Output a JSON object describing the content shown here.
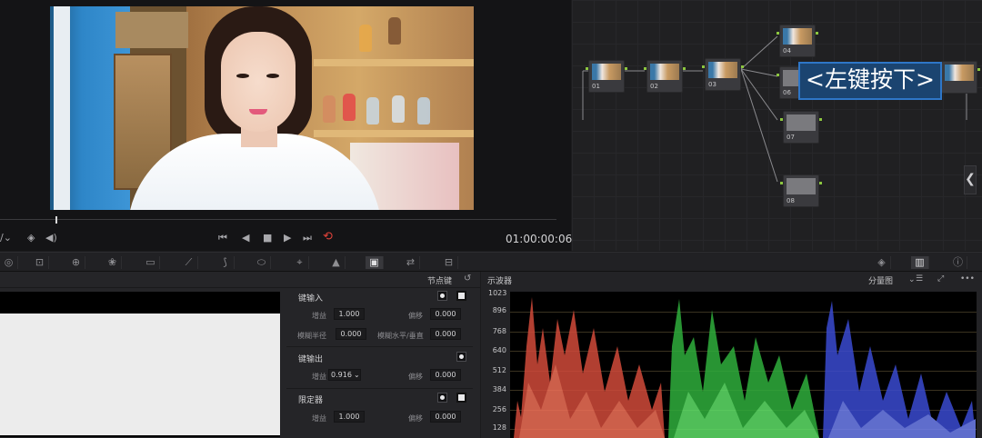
{
  "viewer": {
    "timecode": "01:00:00:06",
    "playhead_progress": 0.1
  },
  "nodes": [
    {
      "label": "01",
      "icons": ""
    },
    {
      "label": "02",
      "icons": "▪"
    },
    {
      "label": "03",
      "icons": "▪ ∕"
    },
    {
      "label": "04",
      "icons": "∕"
    },
    {
      "label": "06",
      "icons": ""
    },
    {
      "label": "07",
      "icons": "▪"
    },
    {
      "label": "08",
      "icons": "∕ ▪"
    }
  ],
  "tooltip": "<左键按下>",
  "key_panel": {
    "title": "节点键",
    "sections": {
      "key_input": "键输入",
      "key_output": "键输出",
      "limiter": "限定器"
    },
    "fields": {
      "input_gain_label": "增益",
      "input_gain_value": "1.000",
      "input_offset_label": "偏移",
      "input_offset_value": "0.000",
      "blur_radius_label": "模糊半径",
      "blur_radius_value": "0.000",
      "blur_hv_label": "模糊水平/垂直",
      "blur_hv_value": "0.000",
      "output_gain_label": "增益",
      "output_gain_value": "0.916",
      "output_offset_label": "偏移",
      "output_offset_value": "0.000",
      "limiter_gain_label": "增益",
      "limiter_gain_value": "1.000",
      "limiter_offset_label": "偏移",
      "limiter_offset_value": "0.000"
    }
  },
  "scope": {
    "title": "示波器",
    "mode": "分量图",
    "scale": [
      "1023",
      "896",
      "768",
      "640",
      "512",
      "384",
      "256",
      "128"
    ]
  },
  "icons": {
    "viewer_toolbar": [
      "eyedropper-icon",
      "layers-icon",
      "audio-icon",
      "skip-back-icon",
      "step-back-icon",
      "stop-icon",
      "play-icon",
      "skip-forward-icon",
      "loop-icon"
    ],
    "palette": [
      "color-wheels-icon",
      "power-window-icon",
      "tracker-icon",
      "rgb-mixer-icon",
      "motion-icon",
      "curves-icon",
      "qualifier-icon",
      "window-icon",
      "tracker-target-icon",
      "magic-mask-icon",
      "blur-icon",
      "key-icon",
      "sizing-icon",
      "3d-icon",
      "scope-icon",
      "info-icon"
    ],
    "colors": {
      "loop": "#e0423a",
      "accent": "#2e76c7",
      "node_link": "#8cc63f",
      "node_key": "#3a9ae0"
    }
  }
}
